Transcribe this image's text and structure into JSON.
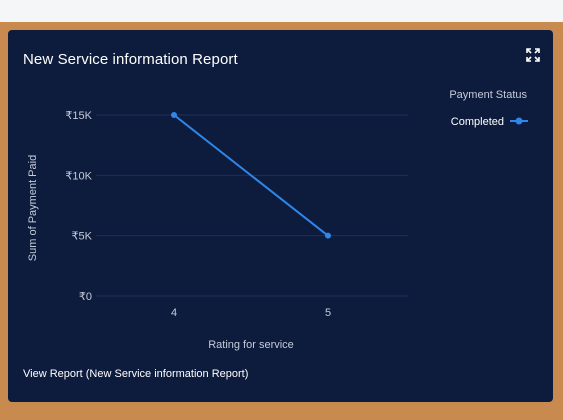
{
  "card": {
    "title": "New Service information Report",
    "expand_icon": "fullscreen-expand-icon",
    "footer_link": "View Report (New Service information Report)"
  },
  "colors": {
    "card_bg": "#0d1b3d",
    "series": "#2f86e8",
    "grid": "#1f3058",
    "text": "#ffffff",
    "tick": "#c5cbd9",
    "page_bg": "#c88a4e"
  },
  "chart_data": {
    "type": "line",
    "categories": [
      "4",
      "5"
    ],
    "series": [
      {
        "name": "Completed",
        "values": [
          15000,
          5000
        ]
      }
    ],
    "yticks": [
      {
        "value": 0,
        "label": "₹0"
      },
      {
        "value": 5000,
        "label": "₹5K"
      },
      {
        "value": 10000,
        "label": "₹10K"
      },
      {
        "value": 15000,
        "label": "₹15K"
      }
    ],
    "ylim": [
      0,
      15000
    ],
    "xlabel": "Rating for service",
    "ylabel": "Sum of Payment Paid",
    "legend_title": "Payment Status",
    "legend_position": "top-right",
    "grid": true
  }
}
